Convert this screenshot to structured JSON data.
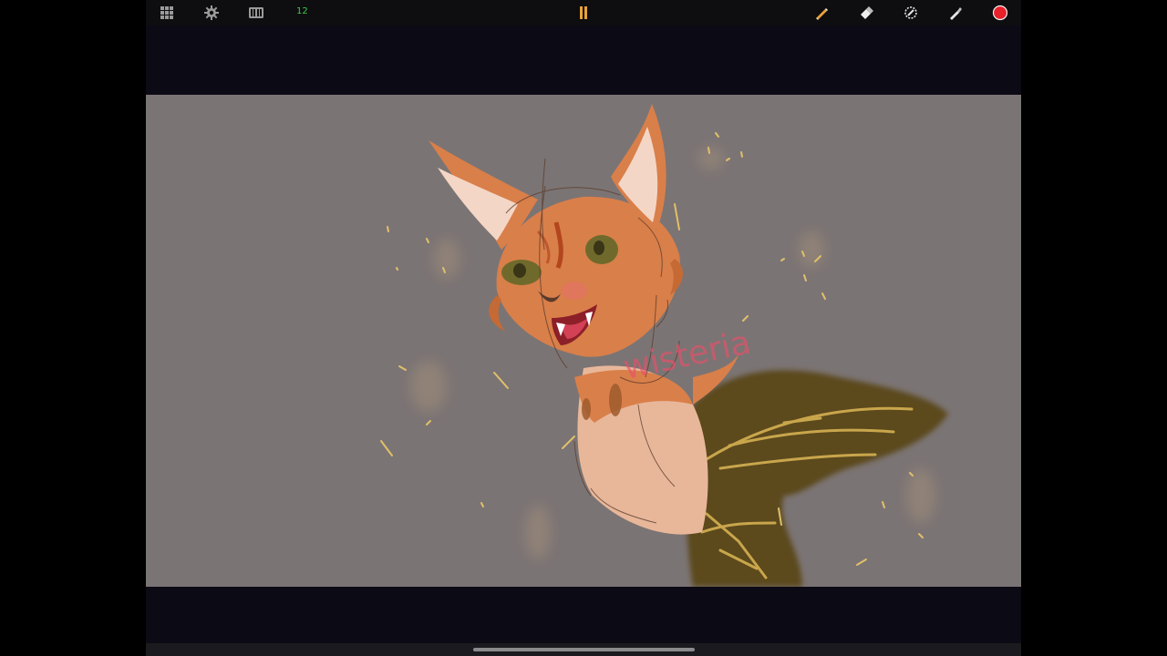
{
  "toolbar": {
    "frame_count": "12",
    "icons": [
      "gallery-grid-icon",
      "settings-gear-icon",
      "filmstrip-icon",
      "pause-icon",
      "pencil-tool-icon",
      "eraser-tool-icon",
      "smudge-tool-icon",
      "eyedropper-icon",
      "color-swatch"
    ],
    "play_state": "paused",
    "current_color": "#e8202a"
  },
  "canvas": {
    "background": "#7b7474",
    "watermark": "wisteria"
  },
  "colors": {
    "accent_frames": "#39c94a",
    "pause": "#e8a23a",
    "toolbar_icon": "#9a9a9a"
  }
}
